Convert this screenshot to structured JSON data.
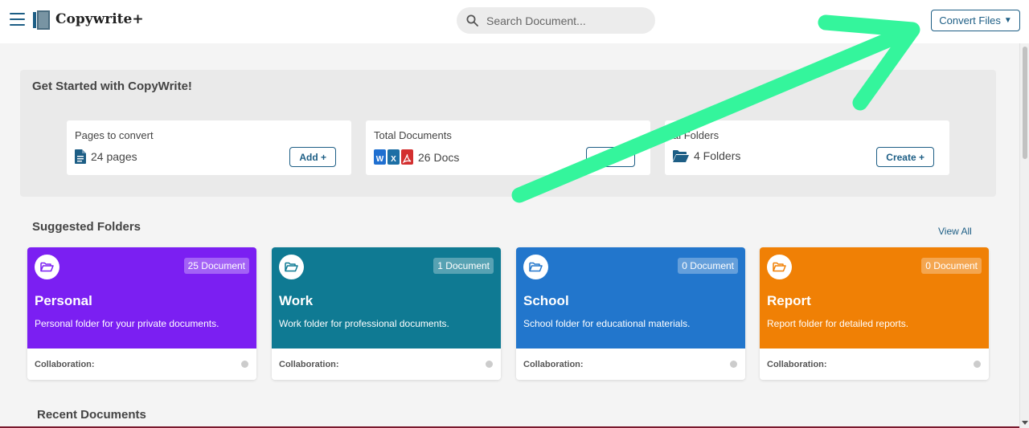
{
  "header": {
    "brand": "Copywrite+",
    "search_placeholder": "Search Document...",
    "convert_label": "Convert Files",
    "convert_caret": "▼"
  },
  "get_started": {
    "title": "Get Started with CopyWrite!",
    "cards": [
      {
        "title": "Pages to convert",
        "value": "24 pages",
        "button": "Add +",
        "icon": "document-icon"
      },
      {
        "title": "Total Documents",
        "value": "26 Docs",
        "button": "",
        "icon": "file-type-badges"
      },
      {
        "title": "al Folders",
        "value": "4 Folders",
        "button": "Create +",
        "icon": "folder-open-icon"
      }
    ],
    "file_badges": [
      "W",
      "X",
      "A"
    ]
  },
  "suggested": {
    "title": "Suggested Folders",
    "view_all": "View All",
    "folders": [
      {
        "name": "Personal",
        "badge": "25 Document",
        "desc": "Personal folder for your private documents.",
        "collab": "Collaboration:",
        "color": "#7b1ff2"
      },
      {
        "name": "Work",
        "badge": "1 Document",
        "desc": "Work folder for professional documents.",
        "collab": "Collaboration:",
        "color": "#0f7a93"
      },
      {
        "name": "School",
        "badge": "0 Document",
        "desc": "School folder for educational materials.",
        "collab": "Collaboration:",
        "color": "#2276cc"
      },
      {
        "name": "Report",
        "badge": "0 Document",
        "desc": "Report folder for detailed reports.",
        "collab": "Collaboration:",
        "color": "#f08005"
      }
    ]
  },
  "recent": {
    "title": "Recent Documents"
  },
  "colors": {
    "accent": "#1d5e85",
    "annotation_arrow": "#34f59c",
    "word": "#1f6fd0",
    "excel": "#1d6fa5",
    "pdf": "#d32f2f"
  }
}
